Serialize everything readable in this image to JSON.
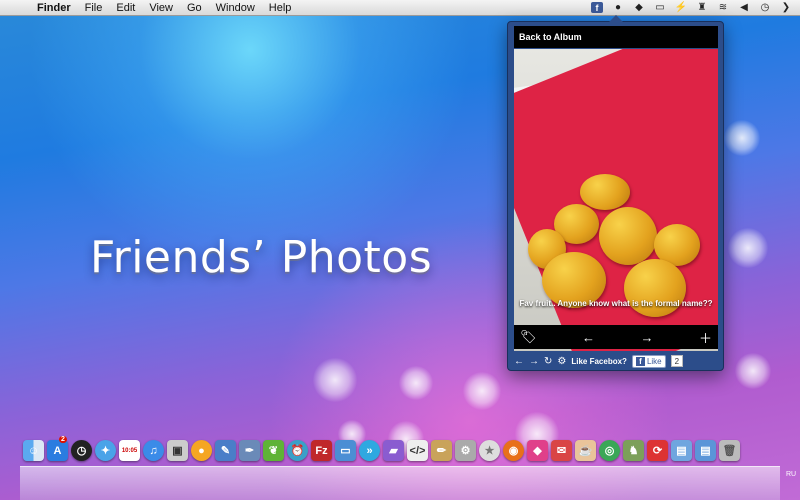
{
  "menubar": {
    "apple_glyph": "",
    "items": [
      "Finder",
      "File",
      "Edit",
      "View",
      "Go",
      "Window",
      "Help"
    ],
    "status_icons": [
      "facebook-icon",
      "record-icon",
      "dropbox-icon",
      "battery-like-icon",
      "plug-icon",
      "stamp-icon",
      "wifi-icon",
      "volume-icon",
      "clock-icon",
      "chevron-icon"
    ],
    "facebook_glyph": "f"
  },
  "hero_title": "Friends’ Photos",
  "popover": {
    "back_label": "Back to Album",
    "caption": "Fav fruit.. Anyone know what is the formal name??",
    "toolbar": {
      "tag": "🏷",
      "prev": "←",
      "next": "→",
      "add": "＋"
    },
    "footer": {
      "back": "←",
      "forward": "→",
      "refresh": "↻",
      "settings": "⚙",
      "like_prompt": "Like Facebox?",
      "like_button": "Like",
      "like_count": "2",
      "f_glyph": "f"
    }
  },
  "dock": {
    "app_icons": [
      "finder",
      "app-store",
      "clock",
      "safari",
      "calendar",
      "itunes",
      "preview",
      "ball",
      "xcode",
      "pen-tool",
      "evernote",
      "alarm",
      "filezilla",
      "screen-sharing",
      "forward",
      "folder-purple",
      "terminal",
      "pencil",
      "gears",
      "star",
      "firefox",
      "ruby",
      "mail",
      "coffee",
      "chrome",
      "chess",
      "sync",
      "folder",
      "folder-blue",
      "trash"
    ],
    "appstore_badge": "2",
    "calendar_date": "10:05",
    "ru_label": "RU"
  },
  "colors": {
    "popover": "#2c4d8a",
    "facebook": "#3b5998",
    "table_red": "#de2345",
    "mango": "#e3a21e"
  }
}
